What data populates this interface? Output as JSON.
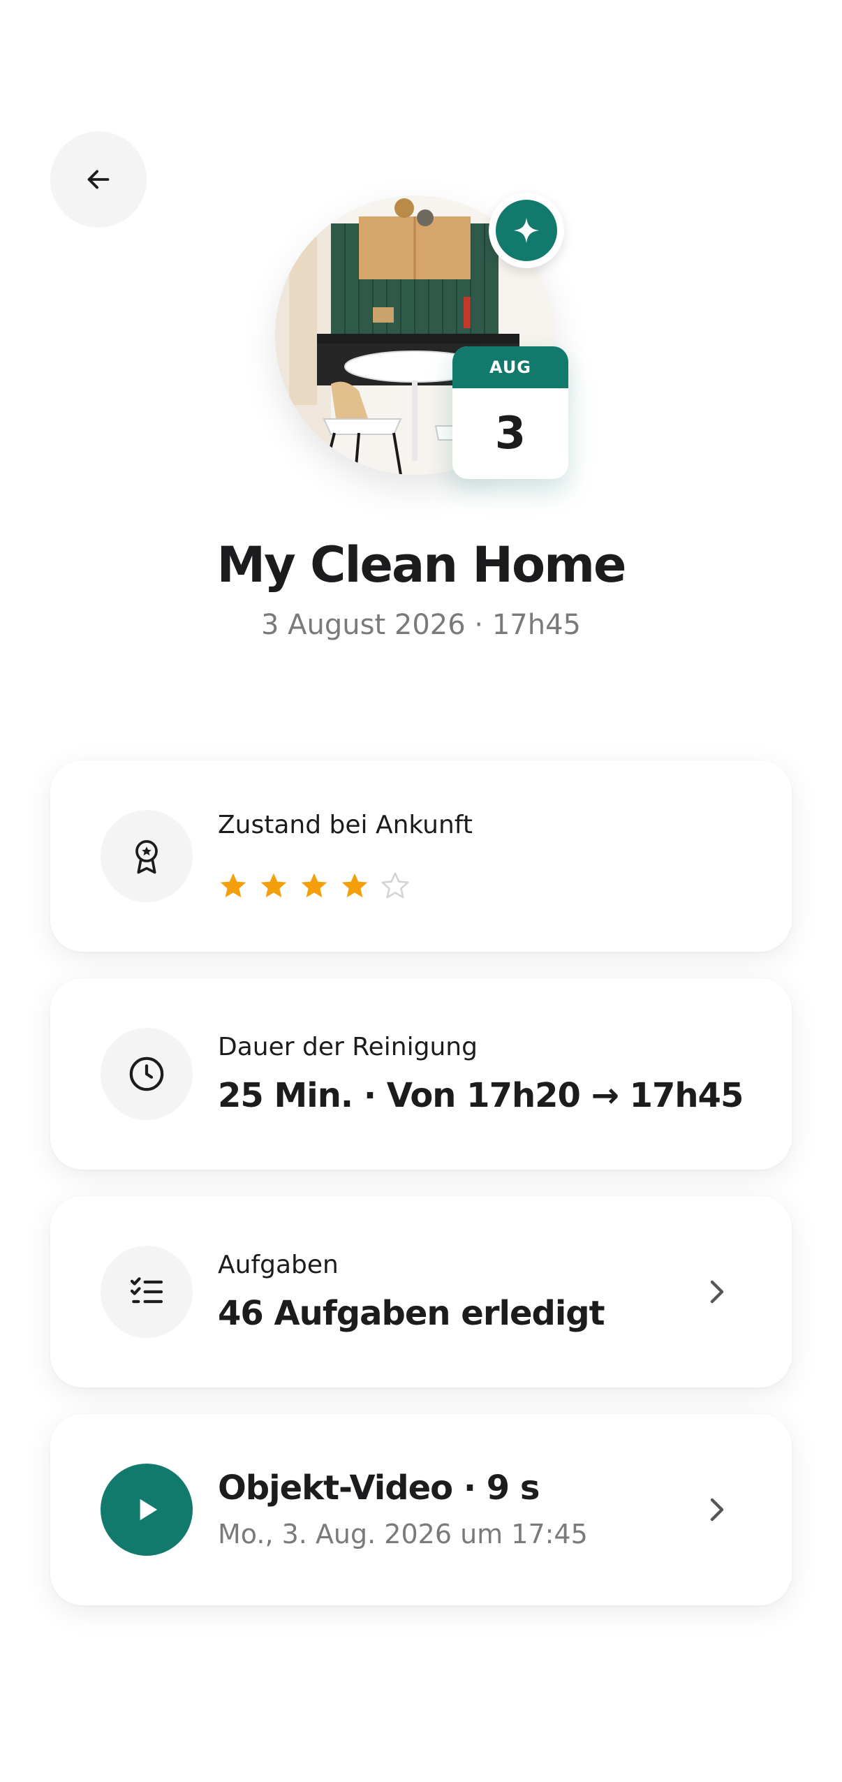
{
  "header": {
    "back_icon": "arrow-left-icon"
  },
  "property": {
    "name": "My Clean Home",
    "datetime": "3 August 2026 · 17h45",
    "calendar": {
      "month": "AUG",
      "day": "3"
    },
    "badge_icon": "sparkle-icon",
    "photo": "kitchen-dining-photo"
  },
  "cards": {
    "condition": {
      "icon": "award-ribbon-icon",
      "label": "Zustand bei Ankunft",
      "rating": 4,
      "rating_max": 5
    },
    "duration": {
      "icon": "clock-icon",
      "label": "Dauer der Reinigung",
      "value": "25 Min. · Von 17h20 → 17h45"
    },
    "tasks": {
      "icon": "checklist-icon",
      "label": "Aufgaben",
      "value": "46 Aufgaben erledigt",
      "chevron_icon": "chevron-right-icon"
    },
    "video": {
      "icon": "play-icon",
      "title": "Objekt-Video · 9 s",
      "meta": "Mo., 3. Aug. 2026 um 17:45",
      "chevron_icon": "chevron-right-icon"
    }
  },
  "colors": {
    "accent": "#127a6c",
    "star": "#f59e0b",
    "star_empty": "#d4d4d4"
  }
}
